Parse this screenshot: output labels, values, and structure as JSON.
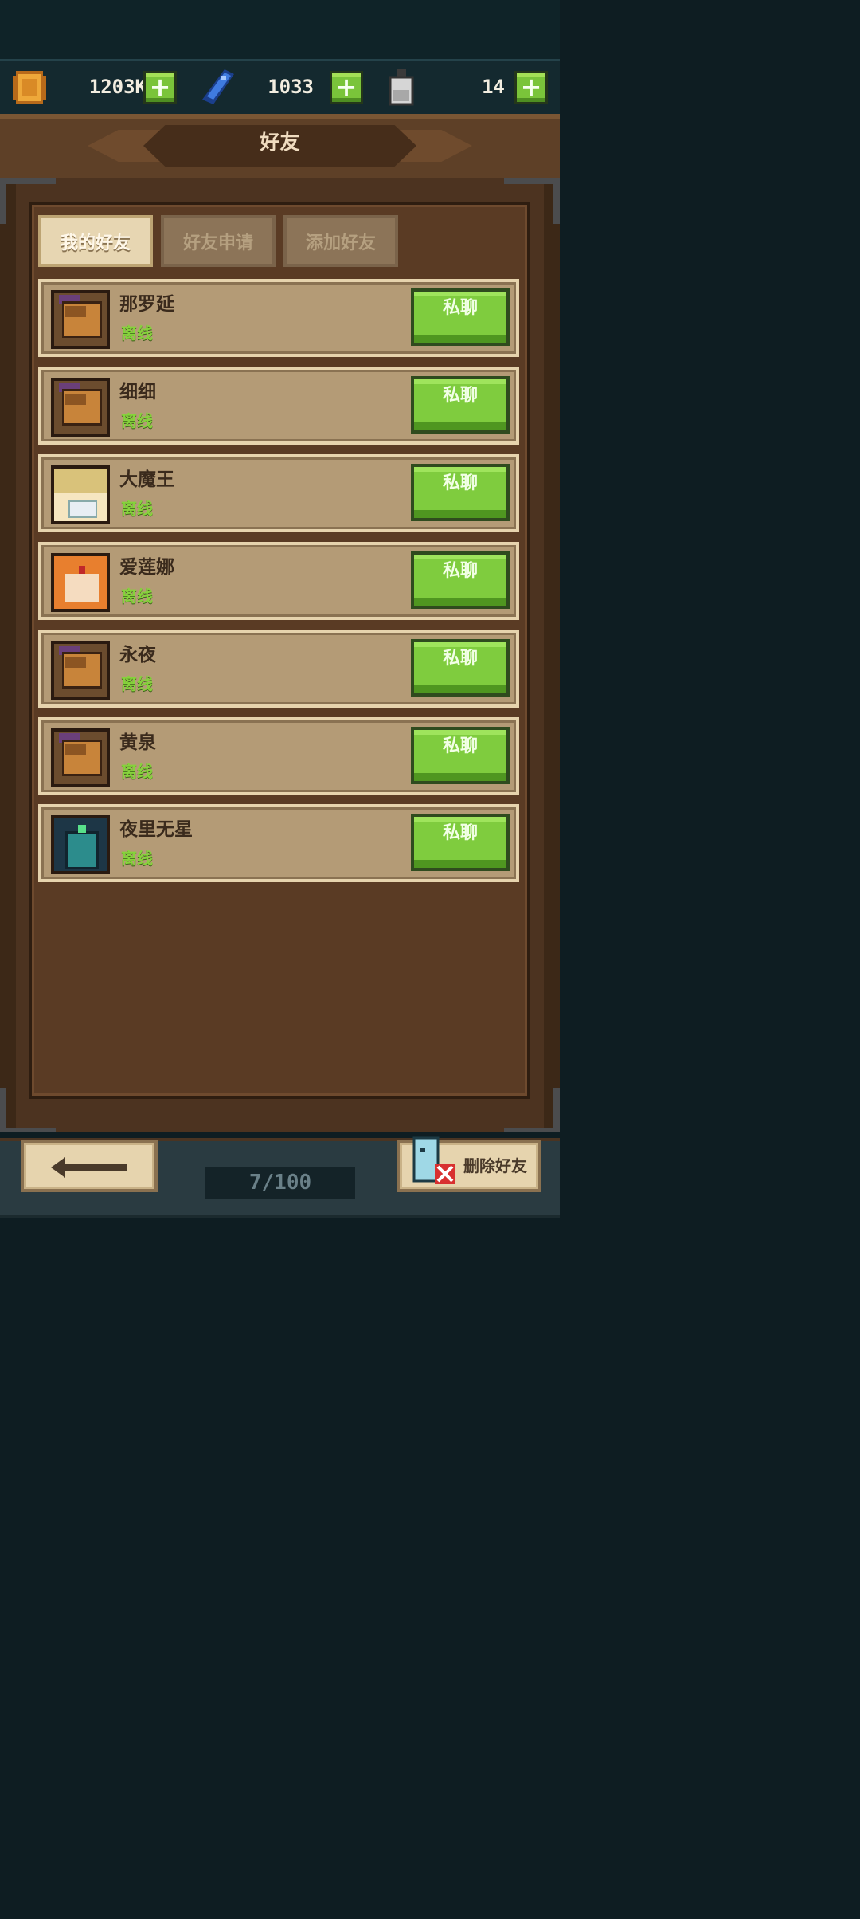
{
  "resources": [
    {
      "name": "gold-coin-icon",
      "value": "1203K",
      "color": "#e9a43a"
    },
    {
      "name": "blue-gem-icon",
      "value": "1033",
      "color": "#3a74d8"
    },
    {
      "name": "potion-bottle-icon",
      "value": "14",
      "color": "#c8c8c8"
    }
  ],
  "header": {
    "title": "好友"
  },
  "tabs": [
    {
      "label": "我的好友",
      "active": true
    },
    {
      "label": "好友申请",
      "active": false
    },
    {
      "label": "添加好友",
      "active": false
    }
  ],
  "friends": [
    {
      "name": "那罗延",
      "status": "离线",
      "avatar": "knight",
      "action": "私聊"
    },
    {
      "name": "细细",
      "status": "离线",
      "avatar": "knight",
      "action": "私聊"
    },
    {
      "name": "大魔王",
      "status": "离线",
      "avatar": "blond-masked",
      "action": "私聊"
    },
    {
      "name": "爱莲娜",
      "status": "离线",
      "avatar": "fox-girl",
      "action": "私聊"
    },
    {
      "name": "永夜",
      "status": "离线",
      "avatar": "knight",
      "action": "私聊"
    },
    {
      "name": "黄泉",
      "status": "离线",
      "avatar": "knight",
      "action": "私聊"
    },
    {
      "name": "夜里无星",
      "status": "离线",
      "avatar": "dark-armor",
      "action": "私聊"
    }
  ],
  "footer": {
    "back_icon": "arrow-left-icon",
    "friend_count": "7/100",
    "delete_label": "删除好友"
  }
}
